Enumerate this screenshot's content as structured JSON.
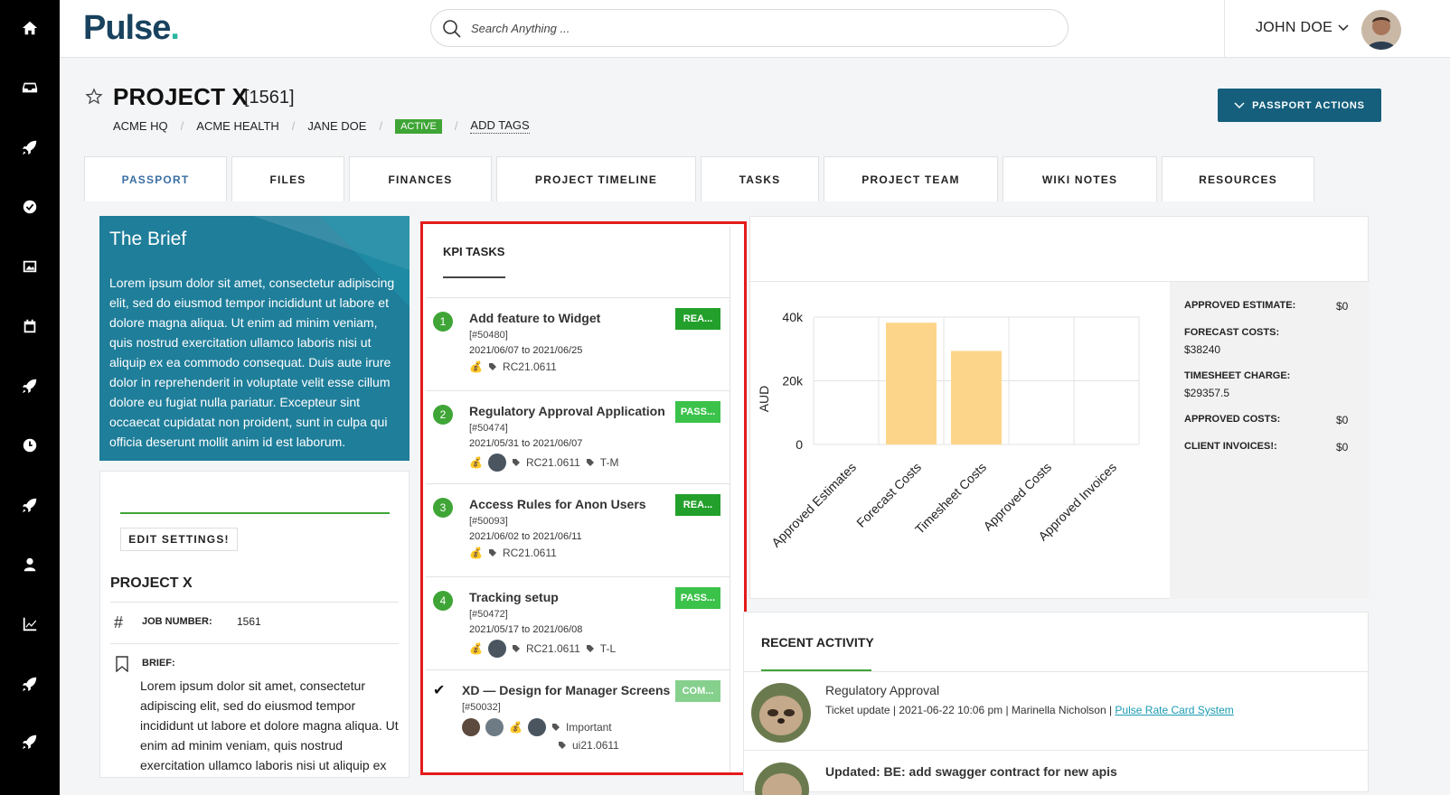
{
  "app": {
    "logo": "Pulse",
    "logo_dot": "."
  },
  "search": {
    "placeholder": "Search Anything ..."
  },
  "user": {
    "name": "JOHN DOE"
  },
  "sidebar": {
    "icons": [
      "home-icon",
      "inbox-icon",
      "rocket-icon",
      "check-circle-icon",
      "image-icon",
      "calendar-icon",
      "rocket-icon",
      "clock-icon",
      "rocket-icon",
      "user-icon",
      "chart-icon",
      "rocket-icon",
      "rocket-icon"
    ]
  },
  "header": {
    "title": "PROJECT X",
    "number": "[1561]",
    "breadcrumbs": [
      "ACME HQ",
      "ACME HEALTH",
      "JANE DOE"
    ],
    "status_badge": "ACTIVE",
    "add_tags": "ADD TAGS",
    "actions_button": "PASSPORT ACTIONS",
    "separator": "/"
  },
  "tabs": [
    "PASSPORT",
    "FILES",
    "FINANCES",
    "PROJECT TIMELINE",
    "TASKS",
    "PROJECT TEAM",
    "WIKI NOTES",
    "RESOURCES"
  ],
  "brief": {
    "title": "The Brief",
    "text": "Lorem ipsum dolor sit amet, consectetur adipiscing elit, sed do eiusmod tempor incididunt ut labore et dolore magna aliqua. Ut enim ad minim veniam, quis nostrud exercitation ullamco laboris nisi ut aliquip ex ea commodo consequat. Duis aute irure dolor in reprehenderit in voluptate velit esse cillum dolore eu fugiat nulla pariatur. Excepteur sint occaecat cupidatat non proident, sunt in culpa qui officia deserunt mollit anim id est laborum."
  },
  "settings": {
    "edit_button": "EDIT SETTINGS!",
    "project_name": "PROJECT X",
    "job_number_label": "JOB NUMBER:",
    "job_number": "1561",
    "brief_label": "BRIEF:",
    "brief_text": "Lorem ipsum dolor sit amet, consectetur adipiscing elit, sed do eiusmod tempor incididunt ut labore et dolore magna aliqua. Ut enim ad minim veniam, quis nostrud exercitation ullamco laboris nisi ut aliquip ex"
  },
  "kpi": {
    "title": "KPI TASKS",
    "tasks": [
      {
        "num": "1",
        "title": "Add feature to Widget",
        "id": "[#50480]",
        "dates": "2021/06/07 to 2021/06/25",
        "tags": [
          "RC21.0611"
        ],
        "status": "REA...",
        "status_type": "ready"
      },
      {
        "num": "2",
        "title": "Regulatory Approval Application",
        "id": "[#50474]",
        "dates": "2021/05/31 to 2021/06/07",
        "tags": [
          "RC21.0611",
          "T-M"
        ],
        "status": "PASS...",
        "status_type": "pass"
      },
      {
        "num": "3",
        "title": "Access Rules for Anon Users",
        "id": "[#50093]",
        "dates": "2021/06/02 to 2021/06/11",
        "tags": [
          "RC21.0611"
        ],
        "status": "REA...",
        "status_type": "ready"
      },
      {
        "num": "4",
        "title": "Tracking setup",
        "id": "[#50472]",
        "dates": "2021/05/17 to 2021/06/08",
        "tags": [
          "RC21.0611",
          "T-L"
        ],
        "status": "PASS...",
        "status_type": "pass"
      },
      {
        "num": "",
        "title": "XD — Design for Manager Screens",
        "id": "[#50032]",
        "dates": "",
        "tags": [
          "Important",
          "ui21.0611"
        ],
        "status": "COM...",
        "status_type": "complete"
      }
    ]
  },
  "chart_data": {
    "type": "bar",
    "categories": [
      "Approved Estimates",
      "Forecast Costs",
      "Timesheet Costs",
      "Approved Costs",
      "Approved Invoices"
    ],
    "values": [
      0,
      38240,
      29357.5,
      0,
      0
    ],
    "ylabel": "AUD",
    "ylim": [
      0,
      40000
    ],
    "yticks": [
      "0",
      "20k",
      "40k"
    ],
    "bar_color": "#fdd58a",
    "grid": true
  },
  "stats": [
    {
      "label": "APPROVED ESTIMATE:",
      "value": "$0"
    },
    {
      "label": "FORECAST COSTS:",
      "value": "$38240"
    },
    {
      "label": "TIMESHEET CHARGE:",
      "value": "$29357.5"
    },
    {
      "label": "APPROVED COSTS:",
      "value": "$0"
    },
    {
      "label": "CLIENT INVOICES!:",
      "value": "$0"
    }
  ],
  "activity": {
    "title": "RECENT ACTIVITY",
    "items": [
      {
        "title": "Regulatory Approval",
        "detail": "Ticket update | 2021-06-22 10:06 pm | Marinella Nicholson | ",
        "link": "Pulse Rate Card System"
      },
      {
        "title": "Updated: BE: add swagger contract for new apis"
      }
    ]
  },
  "colors": {
    "rail": "#000000",
    "brand": "#19425e",
    "accent": "#155f7d",
    "active_green": "#3fa536",
    "brief_bg": "#1f7e9a",
    "highlight_border": "#e41b1b"
  }
}
